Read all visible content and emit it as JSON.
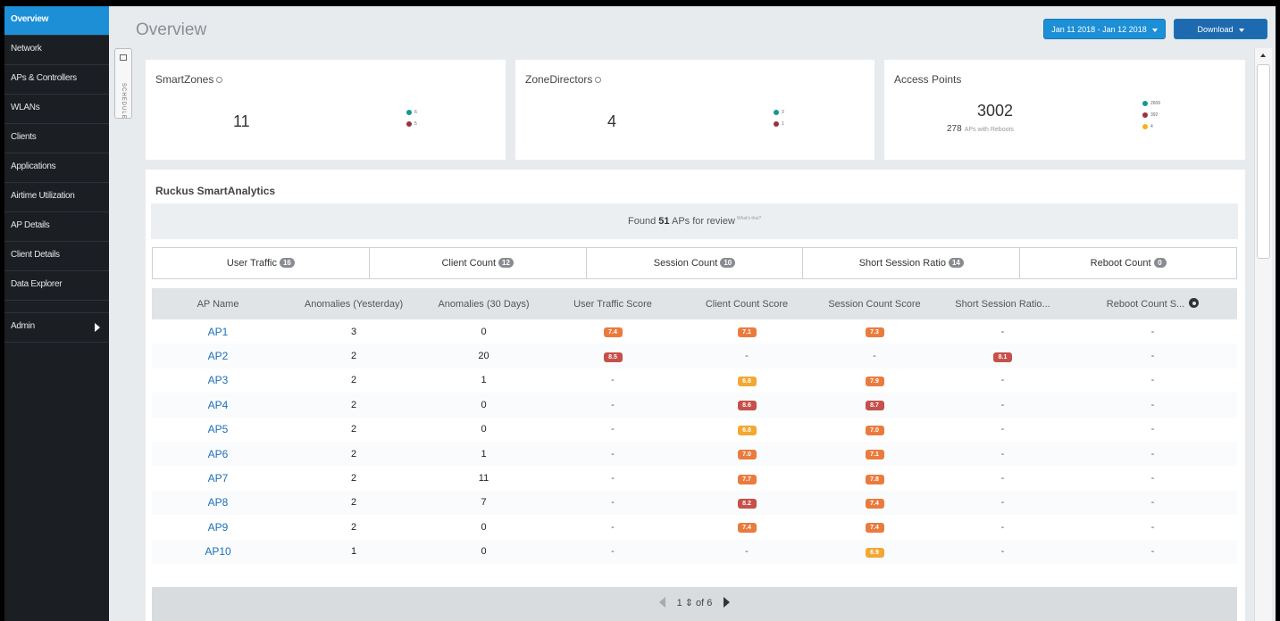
{
  "sidebar": {
    "items": [
      {
        "label": "Overview"
      },
      {
        "label": "Network"
      },
      {
        "label": "APs & Controllers"
      },
      {
        "label": "WLANs"
      },
      {
        "label": "Clients"
      },
      {
        "label": "Applications"
      },
      {
        "label": "Airtime Utilization"
      },
      {
        "label": "AP Details"
      },
      {
        "label": "Client Details"
      },
      {
        "label": "Data Explorer"
      }
    ],
    "admin_label": "Admin"
  },
  "schedule_tab": {
    "label": "SCHEDULE"
  },
  "header": {
    "title": "Overview",
    "date_range": "Jan 11 2018 - Jan 12 2018",
    "download_label": "Download"
  },
  "cards": {
    "smartzones": {
      "title": "SmartZones",
      "total": "11",
      "legend": [
        {
          "value": "6",
          "color": "#139a8e"
        },
        {
          "value": "5",
          "color": "#9b3040"
        }
      ]
    },
    "zonedirectors": {
      "title": "ZoneDirectors",
      "total": "4",
      "legend": [
        {
          "value": "3",
          "color": "#139a8e"
        },
        {
          "value": "1",
          "color": "#9b3040"
        }
      ]
    },
    "access_points": {
      "title": "Access Points",
      "total": "3002",
      "reboots_count": "278",
      "reboots_label": "APs with Reboots",
      "legend": [
        {
          "value": "2606",
          "color": "#139a8e"
        },
        {
          "value": "392",
          "color": "#9b3040"
        },
        {
          "value": "4",
          "color": "#f2b31c"
        }
      ]
    }
  },
  "analytics": {
    "title": "Ruckus SmartAnalytics",
    "found_prefix": "Found",
    "found_count": "51",
    "found_suffix": "APs for review",
    "whats_this": "What's this?",
    "tabs": [
      {
        "label": "User Traffic",
        "count": "16"
      },
      {
        "label": "Client Count",
        "count": "12"
      },
      {
        "label": "Session Count",
        "count": "10"
      },
      {
        "label": "Short Session Ratio",
        "count": "14"
      },
      {
        "label": "Reboot Count",
        "count": "0"
      }
    ],
    "columns": [
      "AP Name",
      "Anomalies (Yesterday)",
      "Anomalies (30 Days)",
      "User Traffic Score",
      "Client Count Score",
      "Session Count Score",
      "Short Session Ratio...",
      "Reboot Count S..."
    ],
    "rows": [
      {
        "name": "AP1",
        "yesterday": "3",
        "days30": "0",
        "scores": [
          "7.4",
          "7.1",
          "7.3",
          "-",
          "-"
        ]
      },
      {
        "name": "AP2",
        "yesterday": "2",
        "days30": "20",
        "scores": [
          "8.5",
          "-",
          "-",
          "8.1",
          "-"
        ]
      },
      {
        "name": "AP3",
        "yesterday": "2",
        "days30": "1",
        "scores": [
          "-",
          "6.8",
          "7.9",
          "-",
          "-"
        ]
      },
      {
        "name": "AP4",
        "yesterday": "2",
        "days30": "0",
        "scores": [
          "-",
          "8.6",
          "8.7",
          "-",
          "-"
        ]
      },
      {
        "name": "AP5",
        "yesterday": "2",
        "days30": "0",
        "scores": [
          "-",
          "6.8",
          "7.0",
          "-",
          "-"
        ]
      },
      {
        "name": "AP6",
        "yesterday": "2",
        "days30": "1",
        "scores": [
          "-",
          "7.0",
          "7.1",
          "-",
          "-"
        ]
      },
      {
        "name": "AP7",
        "yesterday": "2",
        "days30": "11",
        "scores": [
          "-",
          "7.7",
          "7.8",
          "-",
          "-"
        ]
      },
      {
        "name": "AP8",
        "yesterday": "2",
        "days30": "7",
        "scores": [
          "-",
          "8.2",
          "7.4",
          "-",
          "-"
        ]
      },
      {
        "name": "AP9",
        "yesterday": "2",
        "days30": "0",
        "scores": [
          "-",
          "7.4",
          "7.4",
          "-",
          "-"
        ]
      },
      {
        "name": "AP10",
        "yesterday": "1",
        "days30": "0",
        "scores": [
          "-",
          "-",
          "6.9",
          "-",
          "-"
        ]
      }
    ],
    "pager": {
      "page": "1",
      "of_label": "of 6"
    }
  },
  "colors": {
    "accent": "#1c8fd6",
    "score_low": "#f2a832",
    "score_mid": "#ea7b3e",
    "score_high": "#c6504a"
  }
}
